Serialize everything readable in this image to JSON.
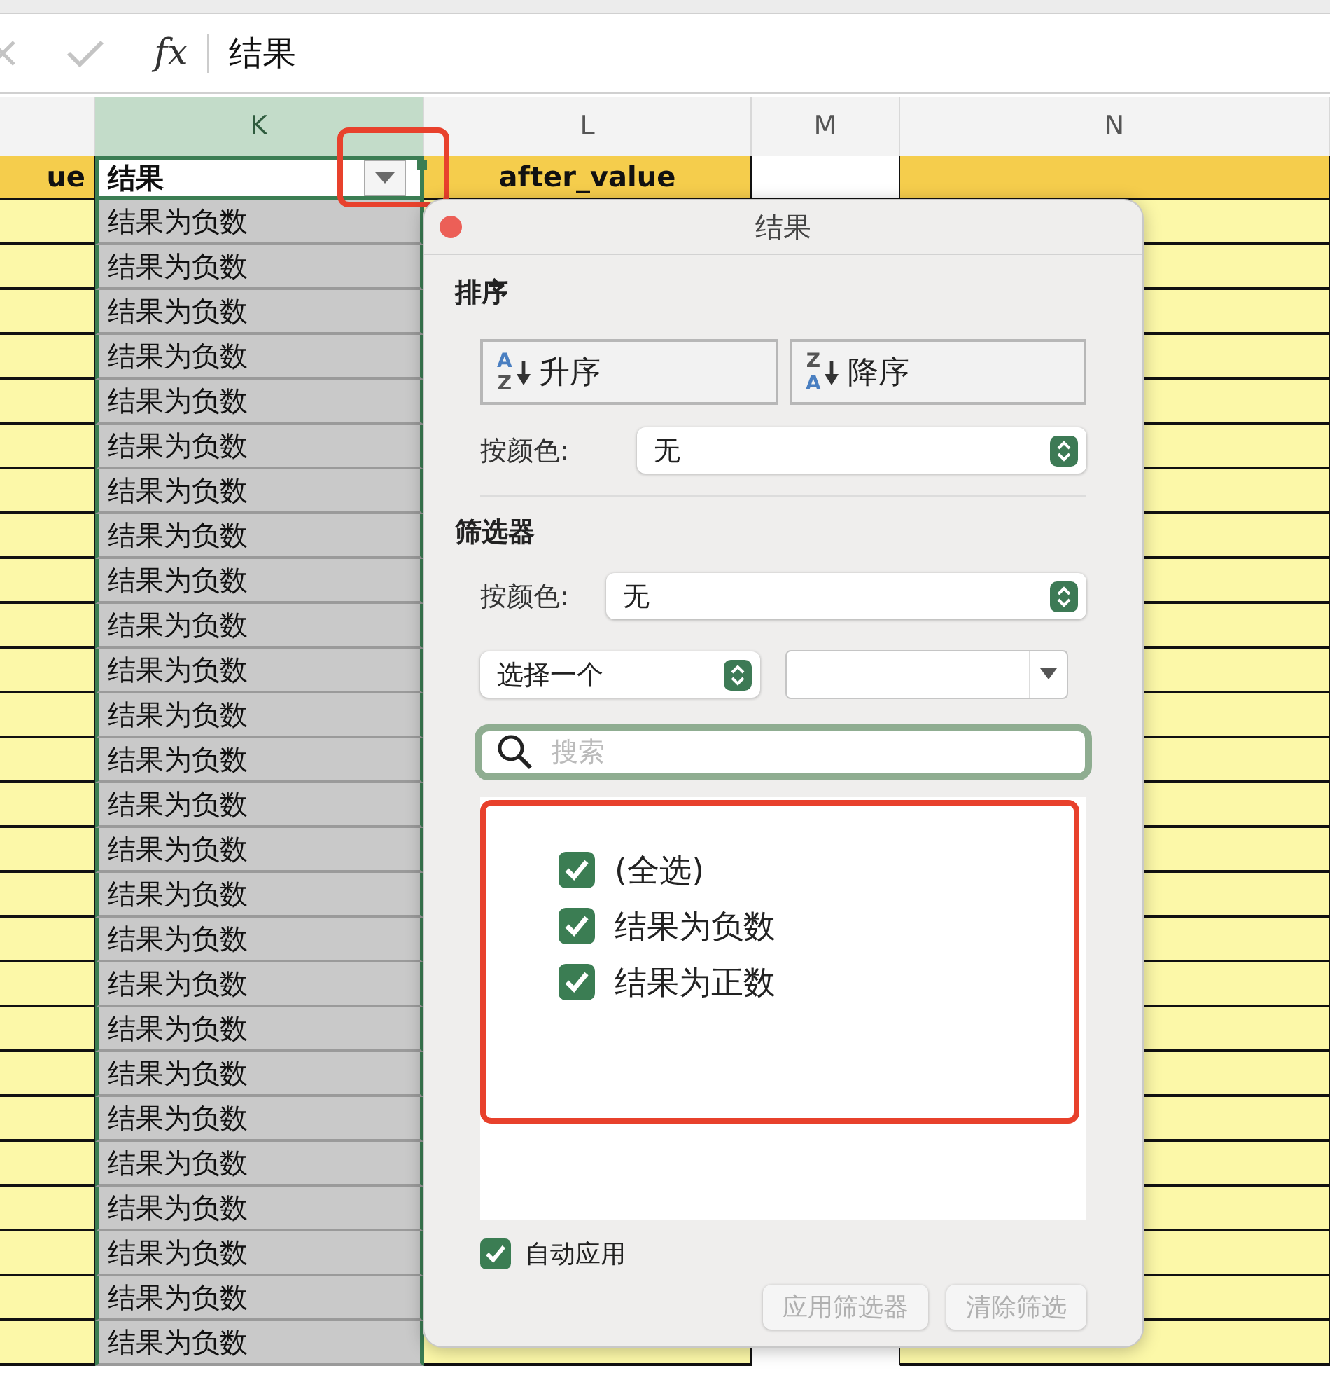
{
  "formula_bar": {
    "function_label": "fx",
    "formula": "结果"
  },
  "columns": [
    {
      "kind": "filled",
      "selected": false,
      "header_cell": "ue"
    },
    {
      "label": "K",
      "kind": "plain",
      "selected": true,
      "header_cell": "结果",
      "filter_button": true
    },
    {
      "label": "L",
      "kind": "filled",
      "selected": false,
      "header_cell": "after_value"
    },
    {
      "label": "M",
      "kind": "plain",
      "selected": false
    },
    {
      "label": "N",
      "kind": "filled",
      "selected": false
    }
  ],
  "rows": [
    {
      "cells": {
        "K": "结果为负数"
      }
    },
    {
      "cells": {
        "K": "结果为负数"
      }
    },
    {
      "cells": {
        "K": "结果为负数"
      }
    },
    {
      "cells": {
        "K": "结果为负数"
      }
    },
    {
      "cells": {
        "K": "结果为负数"
      }
    },
    {
      "cells": {
        "K": "结果为负数"
      }
    },
    {
      "cells": {
        "K": "结果为负数"
      }
    },
    {
      "cells": {
        "K": "结果为负数"
      }
    },
    {
      "cells": {
        "K": "结果为负数"
      }
    },
    {
      "cells": {
        "K": "结果为负数"
      }
    },
    {
      "cells": {
        "K": "结果为负数"
      }
    },
    {
      "cells": {
        "K": "结果为负数"
      }
    },
    {
      "cells": {
        "K": "结果为负数"
      }
    },
    {
      "cells": {
        "K": "结果为负数"
      }
    },
    {
      "cells": {
        "K": "结果为负数"
      }
    },
    {
      "cells": {
        "K": "结果为负数"
      }
    },
    {
      "cells": {
        "K": "结果为负数"
      }
    },
    {
      "cells": {
        "K": "结果为负数"
      }
    },
    {
      "cells": {
        "K": "结果为负数"
      }
    },
    {
      "cells": {
        "K": "结果为负数"
      }
    },
    {
      "cells": {
        "K": "结果为负数"
      }
    },
    {
      "cells": {
        "K": "结果为负数"
      }
    },
    {
      "cells": {
        "K": "结果为负数"
      }
    },
    {
      "cells": {
        "K": "结果为负数"
      }
    },
    {
      "cells": {
        "K": "结果为负数"
      }
    },
    {
      "cells": {
        "K": "结果为负数"
      }
    }
  ],
  "filter_popup": {
    "title": "结果",
    "sort": {
      "heading": "排序",
      "buttons": [
        {
          "kind": "ascending",
          "icon_letters": [
            "A",
            "Z"
          ],
          "label": "升序"
        },
        {
          "kind": "descending",
          "icon_letters": [
            "Z",
            "A"
          ],
          "label": "降序"
        }
      ],
      "color_label": "按颜色:",
      "color_value": "无"
    },
    "filter": {
      "heading": "筛选器",
      "color_label": "按颜色:",
      "color_value": "无",
      "condition": "选择一个",
      "search_placeholder": "搜索",
      "items": [
        {
          "label": "(全选)",
          "checked": true
        },
        {
          "label": "结果为负数",
          "checked": true
        },
        {
          "label": "结果为正数",
          "checked": true
        }
      ]
    },
    "auto_apply": {
      "label": "自动应用",
      "checked": true
    },
    "actions": [
      {
        "label": "应用筛选器",
        "disabled": true
      },
      {
        "label": "清除筛选",
        "disabled": true
      }
    ]
  }
}
